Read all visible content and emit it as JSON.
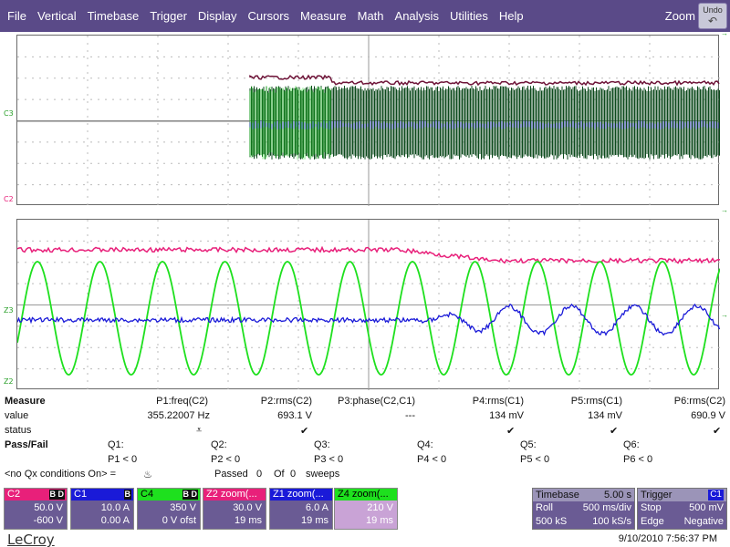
{
  "menu": [
    "File",
    "Vertical",
    "Timebase",
    "Trigger",
    "Display",
    "Cursors",
    "Measure",
    "Math",
    "Analysis",
    "Utilities",
    "Help"
  ],
  "zoom_label": "Zoom",
  "undo_label": "Undo",
  "markers": {
    "grid1_c3": "C3",
    "grid1_c2": "C2",
    "grid2_z3": "Z3",
    "grid2_z2": "Z2"
  },
  "measure": {
    "header_label": "Measure",
    "value_label": "value",
    "status_label": "status",
    "params": [
      {
        "name": "P1:freq(C2)",
        "value": "355.22007 Hz",
        "status": "⩡"
      },
      {
        "name": "P2:rms(C2)",
        "value": "693.1 V",
        "status": "✔"
      },
      {
        "name": "P3:phase(C2,C1)",
        "value": "---",
        "status": ""
      },
      {
        "name": "P4:rms(C1)",
        "value": "134 mV",
        "status": "✔"
      },
      {
        "name": "P5:rms(C1)",
        "value": "134 mV",
        "status": "✔"
      },
      {
        "name": "P6:rms(C2)",
        "value": "690.9 V",
        "status": "✔"
      }
    ],
    "passfail_label": "Pass/Fail",
    "qs": [
      {
        "q": "Q1:",
        "cond": "P1 < 0"
      },
      {
        "q": "Q2:",
        "cond": "P2 < 0"
      },
      {
        "q": "Q3:",
        "cond": "P3 < 0"
      },
      {
        "q": "Q4:",
        "cond": "P4 < 0"
      },
      {
        "q": "Q5:",
        "cond": "P5 < 0"
      },
      {
        "q": "Q6:",
        "cond": "P6 < 0"
      }
    ],
    "no_qx": "<no Qx conditions On> =",
    "passed_label": "Passed",
    "passed_value": "0",
    "of_label": "Of",
    "of_value": "0",
    "sweeps_label": "sweeps"
  },
  "channels": [
    {
      "id": "C2",
      "badge": "B D",
      "line1": "50.0 V",
      "line2": "-600 V",
      "head_color": "#e8207a",
      "head_text_color": "#ffffff"
    },
    {
      "id": "C1",
      "badge": "B",
      "line1": "10.0 A",
      "line2": "0.00 A",
      "head_color": "#1a1ad8",
      "head_text_color": "#ffffff"
    },
    {
      "id": "C4",
      "badge": "B D",
      "line1": "350 V",
      "line2": "0 V ofst",
      "head_color": "#1ee01e",
      "head_text_color": "#000000"
    },
    {
      "id": "Z2 zoom(...",
      "badge": "",
      "line1": "30.0 V",
      "line2": "19 ms",
      "head_color": "#e8207a",
      "head_text_color": "#ffffff"
    },
    {
      "id": "Z1 zoom(...",
      "badge": "",
      "line1": "6.0 A",
      "line2": "19 ms",
      "head_color": "#1a1ad8",
      "head_text_color": "#ffffff"
    },
    {
      "id": "Z4 zoom(...",
      "badge": "",
      "line1": "210 V",
      "line2": "19 ms",
      "head_color": "#1ee01e",
      "head_text_color": "#000000",
      "body_color": "#c9a3d6"
    }
  ],
  "timebase": {
    "title": "Timebase",
    "value": "5.00 s",
    "r1_left": "Roll",
    "r1_right": "500 ms/div",
    "r2_left": "500 kS",
    "r2_right": "100 kS/s"
  },
  "trigger": {
    "title": "Trigger",
    "badge": "C1",
    "r1_left": "Stop",
    "r1_right": "500 mV",
    "r2_left": "Edge",
    "r2_right": "Negative"
  },
  "footer": {
    "logo": "LeCroy",
    "datetime": "9/10/2010 7:56:37 PM"
  },
  "colors": {
    "menubar": "#5a4a88",
    "magenta": "#e8207a",
    "blue": "#1a1ad8",
    "green": "#1ee01e",
    "dark_green": "#0c4a1c",
    "maroon": "#6e1438"
  }
}
